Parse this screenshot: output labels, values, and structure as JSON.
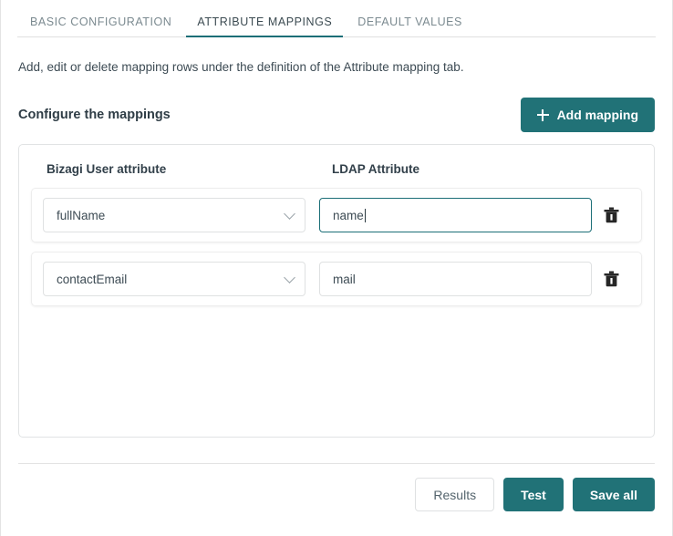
{
  "tabs": [
    {
      "label": "BASIC CONFIGURATION",
      "active": false
    },
    {
      "label": "ATTRIBUTE MAPPINGS",
      "active": true
    },
    {
      "label": "DEFAULT VALUES",
      "active": false
    }
  ],
  "description": "Add, edit or delete mapping rows under the definition of the Attribute mapping tab.",
  "section": {
    "title": "Configure the mappings",
    "add_button_label": "Add mapping",
    "add_button_icon": "plus-icon"
  },
  "table": {
    "headers": {
      "bizagi": "Bizagi User attribute",
      "ldap": "LDAP Attribute"
    },
    "rows": [
      {
        "bizagi_attribute": "fullName",
        "ldap_attribute": "name",
        "ldap_placeholder": "",
        "focused": true,
        "delete_icon": "trash-icon"
      },
      {
        "bizagi_attribute": "contactEmail",
        "ldap_attribute": "mail",
        "ldap_placeholder": "",
        "focused": false,
        "delete_icon": "trash-icon"
      }
    ]
  },
  "footer": {
    "results_label": "Results",
    "test_label": "Test",
    "save_label": "Save all"
  },
  "colors": {
    "accent": "#217277",
    "tab_underline": "#1b6e77",
    "text": "#3d4b54",
    "border": "#dfe1e2"
  }
}
